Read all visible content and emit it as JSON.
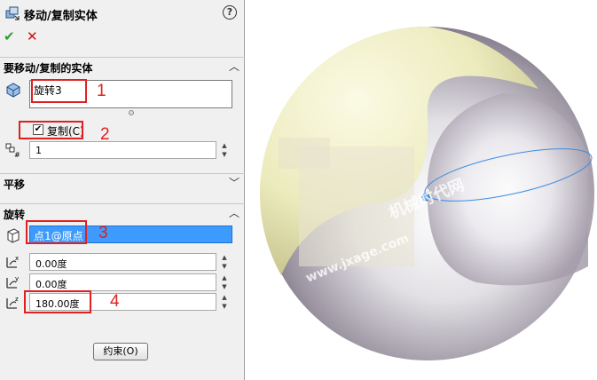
{
  "title": "移动/复制实体",
  "help_glyph": "?",
  "ok_glyph": "✔",
  "cancel_glyph": "✕",
  "sections": {
    "bodies": {
      "label": "要移动/复制的实体",
      "chevron": "︿"
    },
    "translate": {
      "label": "平移",
      "chevron": "﹀"
    },
    "rotate": {
      "label": "旋转",
      "chevron": "︿"
    }
  },
  "bodies_selection": "旋转3",
  "copy": {
    "label": "复制(C)",
    "checked": true,
    "check_glyph": "✔"
  },
  "copy_count": "1",
  "rotate_reference": "点1@原点",
  "rotate_x": "0.00度",
  "rotate_y": "0.00度",
  "rotate_z": "180.00度",
  "spin_glyph": "▲\n▼",
  "constraints_button": "约束(O)",
  "callouts": [
    "1",
    "2",
    "3",
    "4"
  ],
  "watermark": {
    "line1": "机械时代网",
    "line2": "www.jxage.com"
  },
  "colors": {
    "red": "#e02020",
    "selection": "#3d9bff",
    "sphere_body": "#e8e4b0",
    "shell": "#cfc8d4"
  },
  "icons": [
    "move-copy-icon",
    "help-icon",
    "ok-check-icon",
    "cancel-x-icon",
    "body-select-icon",
    "copy-count-icon",
    "point-select-icon",
    "rotate-x-icon",
    "rotate-y-icon",
    "rotate-z-icon",
    "collapse-chevron-icon",
    "expand-chevron-icon"
  ]
}
